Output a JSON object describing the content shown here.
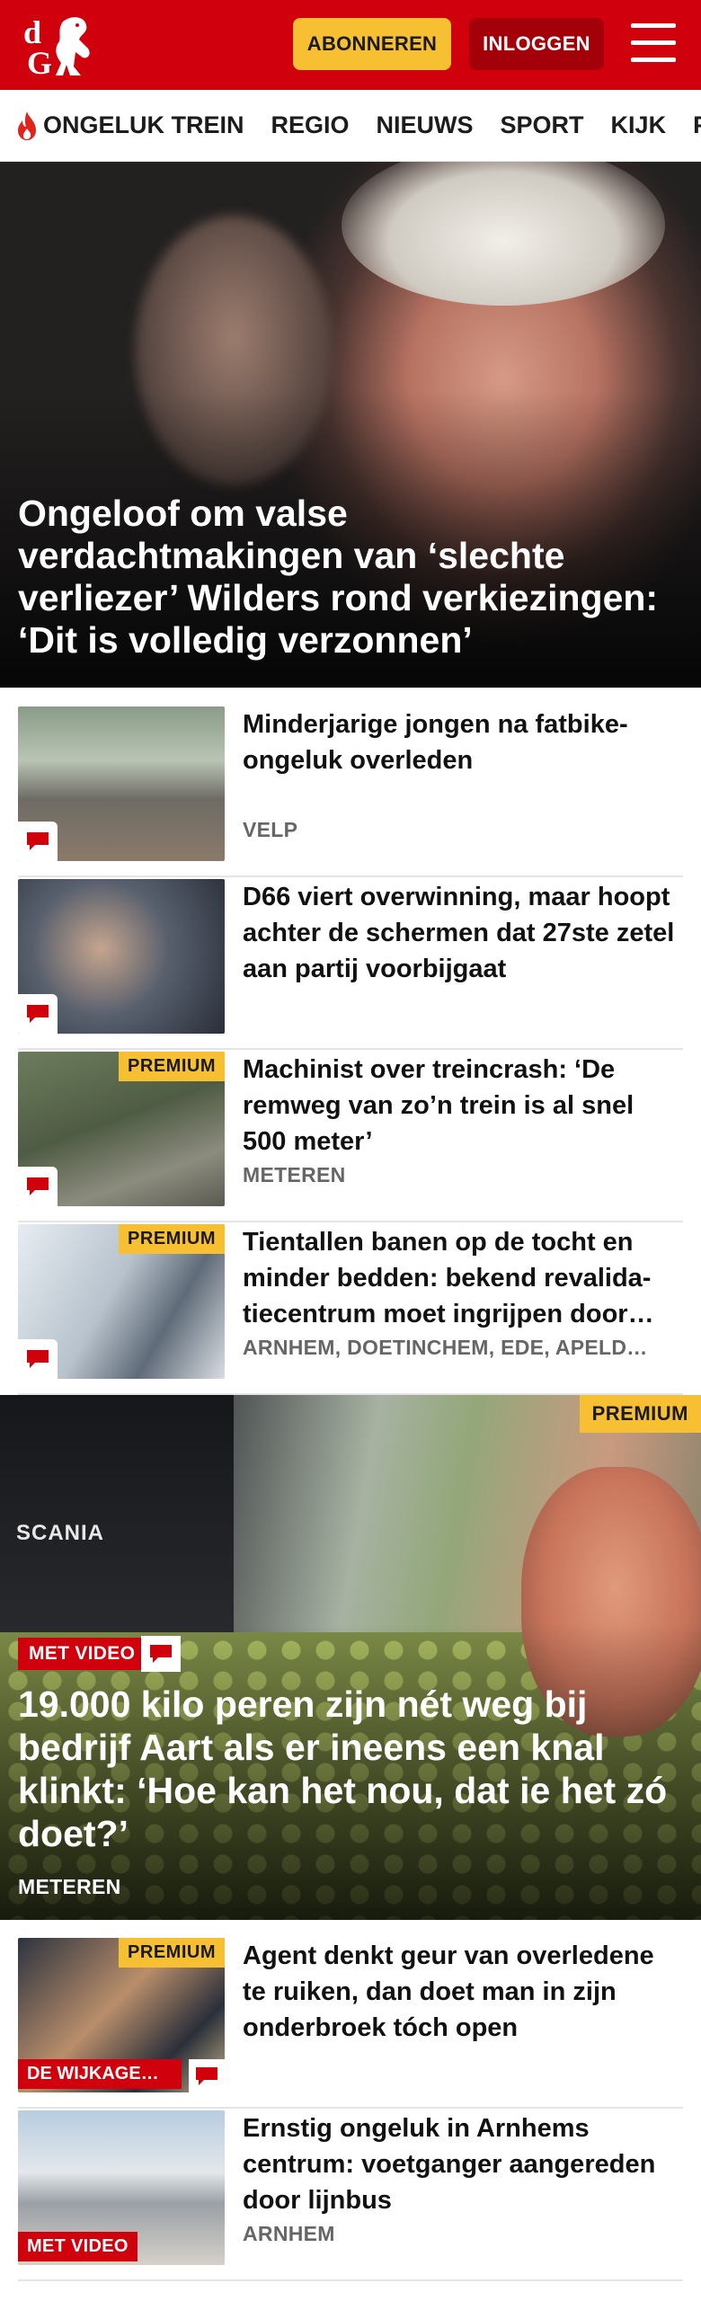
{
  "header": {
    "logo_text": "dG",
    "subscribe_label": "ABONNEREN",
    "login_label": "INLOGGEN",
    "brand_color": "#d0000d",
    "accent_color": "#f7c033"
  },
  "nav": {
    "items": [
      {
        "label": "ONGELUK TREIN",
        "icon": "flame-icon"
      },
      {
        "label": "REGIO"
      },
      {
        "label": "NIEUWS"
      },
      {
        "label": "SPORT"
      },
      {
        "label": "KIJK"
      },
      {
        "label": "POD"
      }
    ]
  },
  "hero": {
    "title": "Ongeloof om valse verdachtmakingen van ‘slechte verliezer’ Wilders rond verkiezingen: ‘Dit is volledig verzonnen’"
  },
  "articles": [
    {
      "title": "Minderjarige jongen na fatbike-ongeluk overleden",
      "location": "VELP"
    },
    {
      "title": "D66 viert overwinning, maar hoopt achter de schermen dat 27ste zetel aan partij voorbijgaat",
      "location": ""
    },
    {
      "title": "Machinist over treincrash: ‘De remweg van zo’n trein is al snel 500 meter’",
      "location": "METEREN",
      "badge": "PREMIUM"
    },
    {
      "title": "Tientallen banen op de tocht en minder bedden: bekend revalida-tiecentrum moet ingrijpen door…",
      "location": "ARNHEM, DOETINCHEM, EDE, APELD…",
      "badge": "PREMIUM"
    }
  ],
  "feature": {
    "badge": "PREMIUM",
    "video_tag": "MET VIDEO",
    "truck_brand": "SCANIA",
    "title": "19.000 kilo peren zijn nét weg bij bedrijf Aart als er ineens een knal klinkt: ‘Hoe kan het nou, dat ie het zó doet?’",
    "location": "METEREN"
  },
  "articles2": [
    {
      "title": "Agent denkt geur van overledene te ruiken, dan doet man in zijn onderbroek tóch open",
      "badge": "PREMIUM",
      "tag": "DE WIJKAGE…"
    },
    {
      "title": "Ernstig ongeluk in Arnhems centrum: voetganger aangereden door lijnbus",
      "location": "ARNHEM",
      "tag": "MET VIDEO"
    }
  ]
}
